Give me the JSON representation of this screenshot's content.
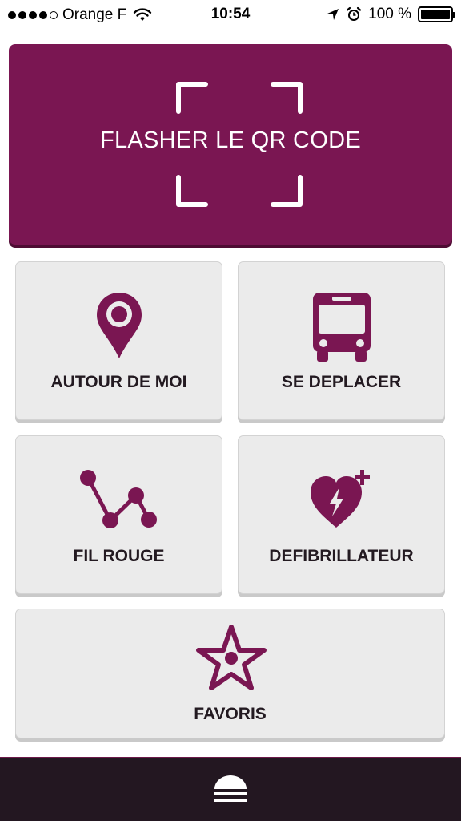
{
  "status_bar": {
    "carrier": "Orange F",
    "time": "10:54",
    "battery_percent": "100 %",
    "battery_level": 1.0,
    "signal_bars": 4,
    "icons": [
      "wifi-icon",
      "location-arrow-icon",
      "alarm-clock-icon",
      "battery-icon"
    ]
  },
  "qr_banner": {
    "label": "FLASHER LE QR CODE",
    "icon": "qr-scan-frame-icon",
    "background": "#7a1652"
  },
  "tiles": [
    {
      "label": "AUTOUR DE MOI",
      "icon": "map-pin-icon"
    },
    {
      "label": "SE DEPLACER",
      "icon": "bus-icon"
    },
    {
      "label": "FIL ROUGE",
      "icon": "route-path-icon"
    },
    {
      "label": "DEFIBRILLATEUR",
      "icon": "heart-defibrillator-icon"
    },
    {
      "label": "FAVORIS",
      "icon": "star-icon"
    }
  ],
  "bottom_bar": {
    "icon": "home-icon",
    "background": "#231721"
  },
  "colors": {
    "accent": "#7a1652",
    "tile_background": "#ebebeb",
    "tile_text": "#231a21"
  }
}
